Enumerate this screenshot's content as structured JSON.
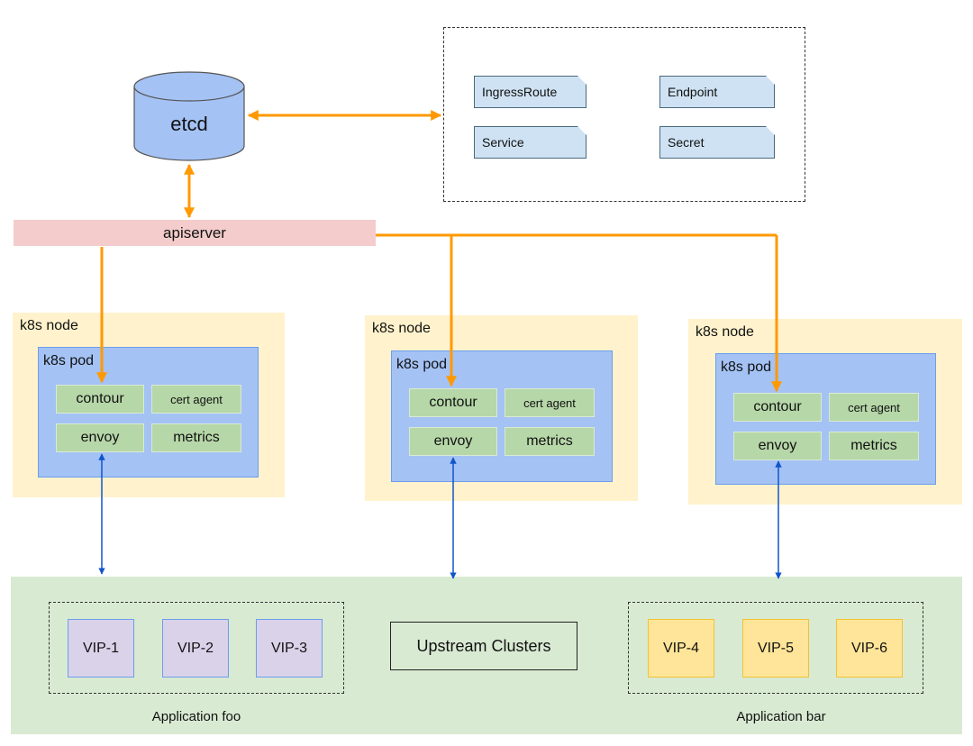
{
  "etcd": {
    "label": "etcd"
  },
  "resources": [
    "IngressRoute",
    "Endpoint",
    "Service",
    "Secret"
  ],
  "apiserver": {
    "label": "apiserver"
  },
  "nodes": [
    {
      "node_label": "k8s node",
      "pod_label": "k8s pod",
      "components": [
        "contour",
        "cert agent",
        "envoy",
        "metrics"
      ]
    },
    {
      "node_label": "k8s node",
      "pod_label": "k8s pod",
      "components": [
        "contour",
        "cert agent",
        "envoy",
        "metrics"
      ]
    },
    {
      "node_label": "k8s node",
      "pod_label": "k8s pod",
      "components": [
        "contour",
        "cert agent",
        "envoy",
        "metrics"
      ]
    }
  ],
  "upstream": {
    "label": "Upstream Clusters",
    "app_foo": {
      "label": "Application foo",
      "vips": [
        "VIP-1",
        "VIP-2",
        "VIP-3"
      ]
    },
    "app_bar": {
      "label": "Application bar",
      "vips": [
        "VIP-4",
        "VIP-5",
        "VIP-6"
      ]
    }
  },
  "colors": {
    "control_arrow": "#ff9900",
    "data_arrow": "#1155cc",
    "etcd": "#a4c2f4",
    "apiserver": "#f4cccc",
    "node": "#fff2cc",
    "pod": "#a4c2f4",
    "component": "#b6d7a8",
    "upstream_bg": "#d9ead3"
  }
}
